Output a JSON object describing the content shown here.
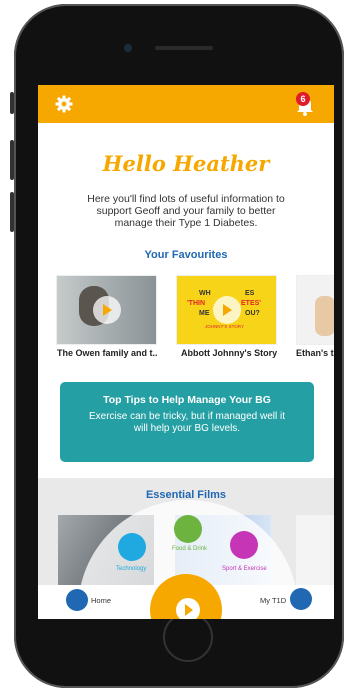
{
  "topbar": {
    "notification_count": "6"
  },
  "greeting": "Hello Heather",
  "intro": "Here you'll find lots of useful information to support Geoff and your family to better manage their Type 1 Diabetes.",
  "favourites": {
    "title": "Your Favourites",
    "items": [
      {
        "caption": "The Owen family and t.."
      },
      {
        "caption": "Abbott Johnny's Story",
        "thumb_text_1": "WH",
        "thumb_text_2": "ES",
        "thumb_text_3": "'THIN",
        "thumb_text_4": "ETES'",
        "thumb_text_5": "ME",
        "thumb_text_6": "OU?",
        "thumb_text_7": "JOHNNY'S STORY"
      },
      {
        "caption": "Ethan's ta"
      }
    ]
  },
  "tips": {
    "title": "Top Tips to Help Manage Your BG",
    "body": "Exercise can be tricky, but if managed well it will help your BG levels."
  },
  "essential": {
    "title": "Essential Films",
    "categories": [
      {
        "label": "Food & Drink",
        "color": "#6cb33f"
      },
      {
        "label": "Technology",
        "color": "#1fa9e0"
      },
      {
        "label": "Sport & Exercise",
        "color": "#c535b5"
      }
    ]
  },
  "nav": {
    "home_label": "Home",
    "my_label": "My T1D"
  },
  "colors": {
    "accent": "#f6a800",
    "blue": "#2168b3",
    "teal": "#24a0a4"
  }
}
